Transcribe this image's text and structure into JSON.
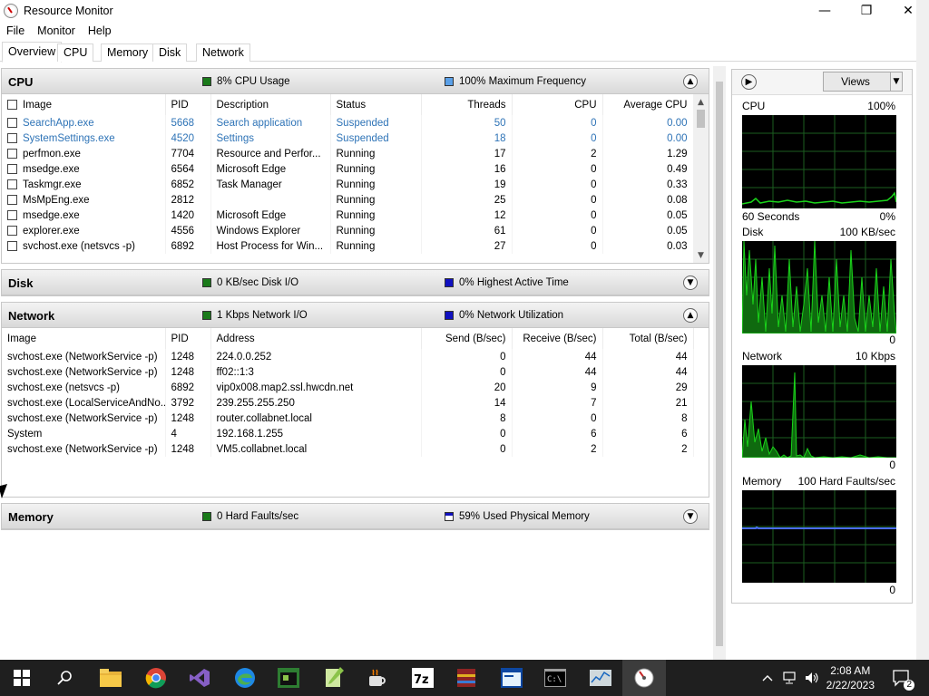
{
  "window": {
    "title": "Resource Monitor"
  },
  "menu": [
    "File",
    "Monitor",
    "Help"
  ],
  "tabs": [
    "Overview",
    "CPU",
    "Memory",
    "Disk",
    "Network"
  ],
  "colors": {
    "green": "#1a7a1a",
    "blue": "#1010c0",
    "lightblue": "#5aa0e8",
    "process_blue": "#2f74b7",
    "graph_green": "#1ad41a"
  },
  "cpu_panel": {
    "title": "CPU",
    "stat1": "8% CPU Usage",
    "stat2": "100% Maximum Frequency",
    "columns": [
      "Image",
      "PID",
      "Description",
      "Status",
      "Threads",
      "CPU",
      "Average CPU"
    ],
    "rows": [
      [
        "SearchApp.exe",
        "5668",
        "Search application",
        "Suspended",
        "50",
        "0",
        "0.00"
      ],
      [
        "SystemSettings.exe",
        "4520",
        "Settings",
        "Suspended",
        "18",
        "0",
        "0.00"
      ],
      [
        "perfmon.exe",
        "7704",
        "Resource and Perfor...",
        "Running",
        "17",
        "2",
        "1.29"
      ],
      [
        "msedge.exe",
        "6564",
        "Microsoft Edge",
        "Running",
        "16",
        "0",
        "0.49"
      ],
      [
        "Taskmgr.exe",
        "6852",
        "Task Manager",
        "Running",
        "19",
        "0",
        "0.33"
      ],
      [
        "MsMpEng.exe",
        "2812",
        "",
        "Running",
        "25",
        "0",
        "0.08"
      ],
      [
        "msedge.exe",
        "1420",
        "Microsoft Edge",
        "Running",
        "12",
        "0",
        "0.05"
      ],
      [
        "explorer.exe",
        "4556",
        "Windows Explorer",
        "Running",
        "61",
        "0",
        "0.05"
      ],
      [
        "svchost.exe (netsvcs -p)",
        "6892",
        "Host Process for Win...",
        "Running",
        "27",
        "0",
        "0.03"
      ]
    ]
  },
  "disk_panel": {
    "title": "Disk",
    "stat1": "0 KB/sec Disk I/O",
    "stat2": "0% Highest Active Time"
  },
  "network_panel": {
    "title": "Network",
    "stat1": "1 Kbps Network I/O",
    "stat2": "0% Network Utilization",
    "columns": [
      "Image",
      "PID",
      "Address",
      "Send (B/sec)",
      "Receive (B/sec)",
      "Total (B/sec)"
    ],
    "rows": [
      [
        "svchost.exe (NetworkService -p)",
        "1248",
        "224.0.0.252",
        "0",
        "44",
        "44"
      ],
      [
        "svchost.exe (NetworkService -p)",
        "1248",
        "ff02::1:3",
        "0",
        "44",
        "44"
      ],
      [
        "svchost.exe (netsvcs -p)",
        "6892",
        "vip0x008.map2.ssl.hwcdn.net",
        "20",
        "9",
        "29"
      ],
      [
        "svchost.exe (LocalServiceAndNo...",
        "3792",
        "239.255.255.250",
        "14",
        "7",
        "21"
      ],
      [
        "svchost.exe (NetworkService -p)",
        "1248",
        "router.collabnet.local",
        "8",
        "0",
        "8"
      ],
      [
        "System",
        "4",
        "192.168.1.255",
        "0",
        "6",
        "6"
      ],
      [
        "svchost.exe (NetworkService -p)",
        "1248",
        "VM5.collabnet.local",
        "0",
        "2",
        "2"
      ]
    ]
  },
  "memory_panel": {
    "title": "Memory",
    "stat1": "0 Hard Faults/sec",
    "stat2": "59% Used Physical Memory"
  },
  "graphs": {
    "views_label": "Views",
    "cpu": {
      "label": "CPU",
      "max": "100%",
      "sub_left": "60 Seconds",
      "sub_right": "0%"
    },
    "disk": {
      "label": "Disk",
      "max": "100 KB/sec",
      "min": "0"
    },
    "network": {
      "label": "Network",
      "max": "10 Kbps",
      "min": "0"
    },
    "memory": {
      "label": "Memory",
      "max": "100 Hard Faults/sec",
      "min": "0"
    }
  },
  "taskbar": {
    "time": "2:08 AM",
    "date": "2/22/2023",
    "notifications": "2"
  }
}
